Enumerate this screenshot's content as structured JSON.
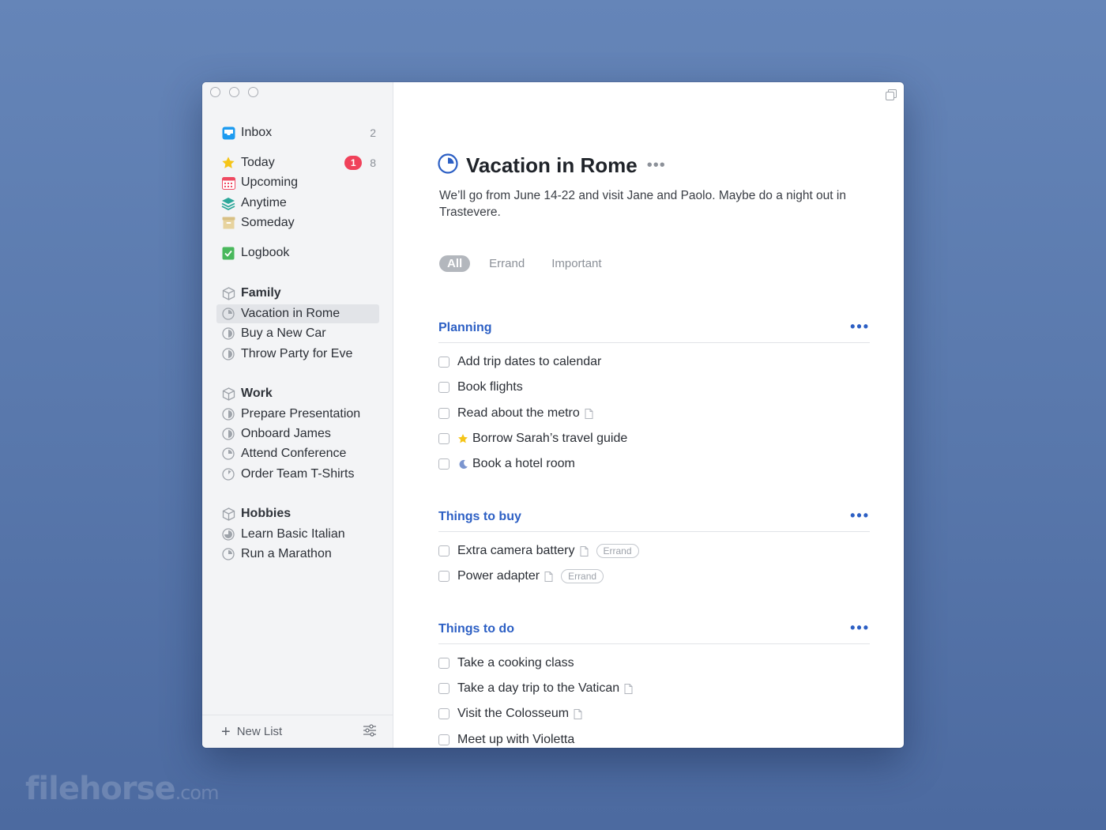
{
  "sidebar": {
    "inbox": {
      "label": "Inbox",
      "count": "2"
    },
    "today": {
      "label": "Today",
      "badge": "1",
      "count": "8"
    },
    "upcoming": {
      "label": "Upcoming"
    },
    "anytime": {
      "label": "Anytime"
    },
    "someday": {
      "label": "Someday"
    },
    "logbook": {
      "label": "Logbook"
    },
    "areas": [
      {
        "name": "Family",
        "projects": [
          "Vacation in Rome",
          "Buy a New Car",
          "Throw Party for Eve"
        ]
      },
      {
        "name": "Work",
        "projects": [
          "Prepare Presentation",
          "Onboard James",
          "Attend Conference",
          "Order Team T-Shirts"
        ]
      },
      {
        "name": "Hobbies",
        "projects": [
          "Learn Basic Italian",
          "Run a Marathon"
        ]
      }
    ],
    "footer": {
      "new_list": "New List"
    }
  },
  "project": {
    "title": "Vacation in Rome",
    "more": "•••",
    "notes": "We’ll go from June 14-22 and visit Jane and Paolo. Maybe do a night out in Trastevere.",
    "tag_filters": [
      "All",
      "Errand",
      "Important"
    ],
    "selected_tag": "All"
  },
  "headings": [
    {
      "title": "Planning",
      "more": "•••",
      "todos": [
        {
          "text": "Add trip dates to calendar"
        },
        {
          "text": "Book flights"
        },
        {
          "text": "Read about the metro",
          "note": true
        },
        {
          "text": "Borrow Sarah’s travel guide",
          "icon": "star-icon"
        },
        {
          "text": "Book a hotel room",
          "icon": "moon-icon"
        }
      ]
    },
    {
      "title": "Things to buy",
      "more": "•••",
      "todos": [
        {
          "text": "Extra camera battery",
          "note": true,
          "tag": "Errand"
        },
        {
          "text": "Power adapter",
          "note": true,
          "tag": "Errand"
        }
      ]
    },
    {
      "title": "Things to do",
      "more": "•••",
      "todos": [
        {
          "text": "Take a cooking class"
        },
        {
          "text": "Take a day trip to the Vatican",
          "note": true
        },
        {
          "text": "Visit the Colosseum",
          "note": true
        },
        {
          "text": "Meet up with Violetta"
        }
      ]
    }
  ],
  "colors": {
    "accent": "#2c5fc4",
    "badge": "#f0415a",
    "today_star": "#f5c518"
  },
  "watermark": {
    "brand": "filehorse",
    "suffix": ".com"
  }
}
